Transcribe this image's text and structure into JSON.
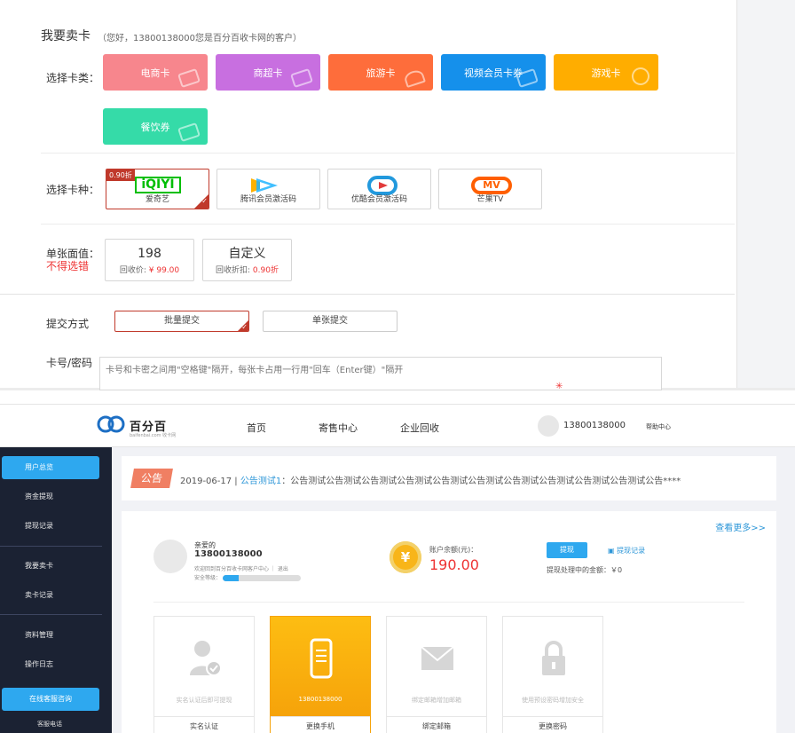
{
  "sell": {
    "title": "我要卖卡",
    "subtitle": "（您好，13800138000您是百分百收卡网的客户）",
    "category_label": "选择卡类：",
    "categories": [
      {
        "label": "电商卡",
        "color": "#f7868d"
      },
      {
        "label": "商超卡",
        "color": "#c86fe0"
      },
      {
        "label": "旅游卡",
        "color": "#fe6d3b"
      },
      {
        "label": "视频会员卡券",
        "color": "#1590eb"
      },
      {
        "label": "游戏卡",
        "color": "#ffad00"
      },
      {
        "label": "餐饮券",
        "color": "#35dba8"
      }
    ],
    "type_label": "选择卡种：",
    "types": [
      {
        "label": "爱奇艺",
        "discount": "0.90折",
        "logo": "iQIYI"
      },
      {
        "label": "腾讯会员激活码"
      },
      {
        "label": "优酷会员激活码"
      },
      {
        "label": "芒果TV",
        "logo": "MV"
      }
    ],
    "value_label": "单张面值：",
    "value_note": "不得选错",
    "values": [
      {
        "big": "198",
        "small_prefix": "回收价: ",
        "small_value": "¥ 99.00"
      },
      {
        "big": "自定义",
        "small_prefix": "回收折扣: ",
        "small_value": "0.90折"
      }
    ],
    "submit_label": "提交方式",
    "submit_modes": [
      "批量提交",
      "单张提交"
    ],
    "card_label": "卡号/密码",
    "card_placeholder": "卡号和卡密之间用\"空格键\"隔开，每张卡占用一行用\"回车（Enter键）\"隔开"
  },
  "dash": {
    "brand": "百分百",
    "brand_sub": "baifenbai.com 收卡网",
    "nav": [
      "首页",
      "寄售中心",
      "企业回收"
    ],
    "user": "13800138000",
    "help": "帮助中心",
    "sidebar": [
      "用户总览",
      "资金提现",
      "提现记录",
      "我要卖卡",
      "卖卡记录",
      "资料管理",
      "操作日志"
    ],
    "service": "在线客服咨询",
    "hotline": "客服电话",
    "notice": {
      "badge": "公告",
      "date": "2019-06-17",
      "sep": " | ",
      "title": "公告测试1",
      "text": "：公告测试公告测试公告测试公告测试公告测试公告测试公告测试公告测试公告测试公告测试公告****"
    },
    "more": "查看更多>>",
    "profile": {
      "greet": "亲爱的",
      "phone": "13800138000",
      "line": "欢迎回到百分百收卡网客户中心 ｜ 退出",
      "security_label": "安全等级：",
      "security_level": 0.2
    },
    "balance": {
      "coin": "¥",
      "label": "账户余额(元)：",
      "value": "190.00",
      "withdraw": "提现",
      "records": "提现记录",
      "pending": "提现处理中的金额：￥0"
    },
    "tiles": [
      {
        "text": "实名认证后即可提现",
        "bottom": "实名认证"
      },
      {
        "text": "13800138000",
        "bottom": "更换手机"
      },
      {
        "text": "绑定邮箱增加邮箱",
        "bottom": "绑定邮箱"
      },
      {
        "text": "使用预设密码增加安全",
        "bottom": "更换密码"
      }
    ]
  }
}
